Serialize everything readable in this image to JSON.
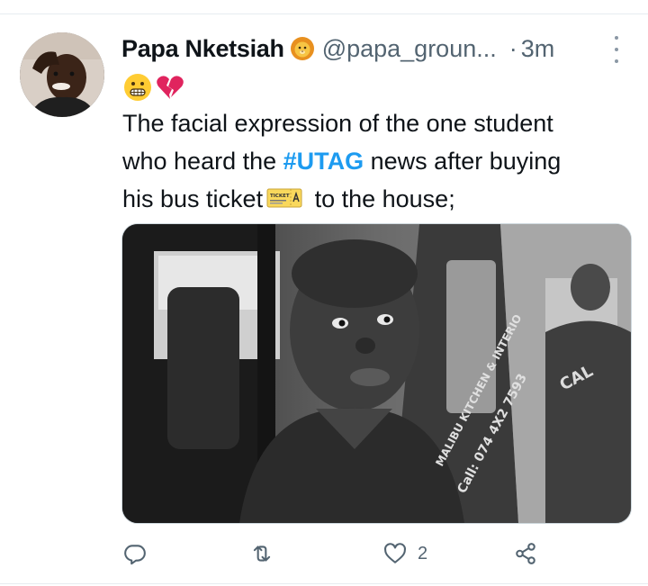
{
  "tweet": {
    "display_name": "Papa Nketsiah",
    "handle": "@papa_groun...",
    "separator": "·",
    "time": "3m",
    "name_badge_icon": "lion-face-icon",
    "emoji_line": [
      "grimacing-face-icon",
      "broken-heart-icon"
    ],
    "text_lines": [
      {
        "pre": "The facial expression of the one student"
      },
      {
        "pre": "who heard the ",
        "hashtag": "#UTAG",
        "post": " news after buying"
      },
      {
        "pre": "his bus ticket",
        "ticket_icon": "ticket-icon",
        "post": " to the house;"
      }
    ],
    "ticket_label": "TICKET",
    "media_overlay_text": [
      "MALIBU KITCHEN & INTERIO",
      "Call: 074 4X2 7593",
      "CAL"
    ],
    "actions": {
      "reply": {
        "icon": "reply-icon",
        "count": ""
      },
      "retweet": {
        "icon": "retweet-icon",
        "count": ""
      },
      "like": {
        "icon": "heart-icon",
        "count": "2"
      },
      "share": {
        "icon": "share-icon",
        "count": ""
      }
    }
  },
  "colors": {
    "link": "#1d9bf0",
    "secondary_text": "#536471",
    "divider": "#e6ecf0",
    "text": "#0f1419"
  }
}
